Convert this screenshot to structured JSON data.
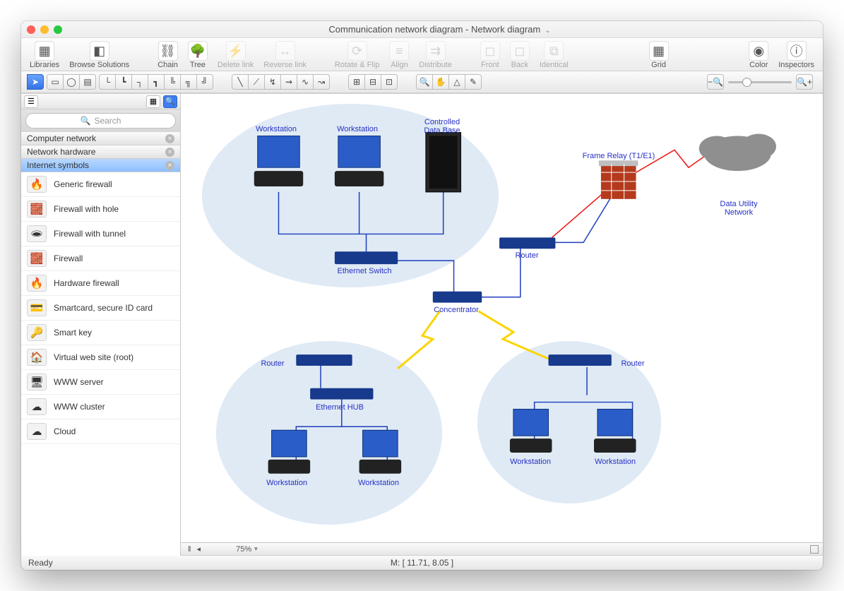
{
  "title": "Communication network diagram - Network diagram",
  "toolbar_main": [
    {
      "id": "libraries",
      "label": "Libraries",
      "glyph": "▦",
      "dis": false
    },
    {
      "id": "browse-solutions",
      "label": "Browse Solutions",
      "glyph": "◧",
      "dis": false
    },
    {
      "id": "chain",
      "label": "Chain",
      "glyph": "⛓",
      "dis": false,
      "group2": true
    },
    {
      "id": "tree",
      "label": "Tree",
      "glyph": "🌳",
      "dis": false
    },
    {
      "id": "delete-link",
      "label": "Delete link",
      "glyph": "⚡",
      "dis": true
    },
    {
      "id": "reverse-link",
      "label": "Reverse link",
      "glyph": "↔",
      "dis": true
    },
    {
      "id": "rotate-flip",
      "label": "Rotate & Flip",
      "glyph": "⟳",
      "dis": true,
      "group3": true
    },
    {
      "id": "align",
      "label": "Align",
      "glyph": "≡",
      "dis": true
    },
    {
      "id": "distribute",
      "label": "Distribute",
      "glyph": "⇉",
      "dis": true
    },
    {
      "id": "front",
      "label": "Front",
      "glyph": "◻",
      "dis": true,
      "group4": true
    },
    {
      "id": "back",
      "label": "Back",
      "glyph": "◻",
      "dis": true
    },
    {
      "id": "identical",
      "label": "Identical",
      "glyph": "⧉",
      "dis": true
    },
    {
      "id": "grid",
      "label": "Grid",
      "glyph": "▦",
      "dis": false,
      "group5": true
    },
    {
      "id": "color",
      "label": "Color",
      "glyph": "◉",
      "dis": false,
      "group6": true
    },
    {
      "id": "inspectors",
      "label": "Inspectors",
      "glyph": "ⓘ",
      "dis": false
    }
  ],
  "sidebar": {
    "search_placeholder": "Search",
    "categories": [
      {
        "label": "Computer network",
        "selected": false
      },
      {
        "label": "Network hardware",
        "selected": false
      },
      {
        "label": "Internet symbols",
        "selected": true
      }
    ],
    "items": [
      {
        "label": "Generic firewall",
        "glyph": "🔥"
      },
      {
        "label": "Firewall with hole",
        "glyph": "🧱"
      },
      {
        "label": "Firewall with tunnel",
        "glyph": "🕳"
      },
      {
        "label": "Firewall",
        "glyph": "🧱"
      },
      {
        "label": "Hardware firewall",
        "glyph": "🔥"
      },
      {
        "label": "Smartcard, secure ID card",
        "glyph": "💳"
      },
      {
        "label": "Smart key",
        "glyph": "🔑"
      },
      {
        "label": "Virtual web site (root)",
        "glyph": "🏠"
      },
      {
        "label": "WWW server",
        "glyph": "🖥"
      },
      {
        "label": "WWW cluster",
        "glyph": "☁"
      },
      {
        "label": "Cloud",
        "glyph": "☁"
      }
    ]
  },
  "canvas": {
    "nodes": {
      "ws1": "Workstation",
      "ws2": "Workstation",
      "cdb": "Controlled\nData Base",
      "esw": "Ethernet Switch",
      "conc": "Concentrator",
      "rtr_top": "Router",
      "frame": "Frame Relay (T1/E1)",
      "dun": "Data Utility\nNetwork",
      "rtr_left": "Router",
      "ehub": "Ethernet HUB",
      "ws3": "Workstation",
      "ws4": "Workstation",
      "rtr_right": "Router",
      "ws5": "Workstation",
      "ws6": "Workstation"
    }
  },
  "bottom": {
    "zoom": "75%",
    "ready": "Ready",
    "mouse": "M: [ 11.71, 8.05 ]"
  }
}
